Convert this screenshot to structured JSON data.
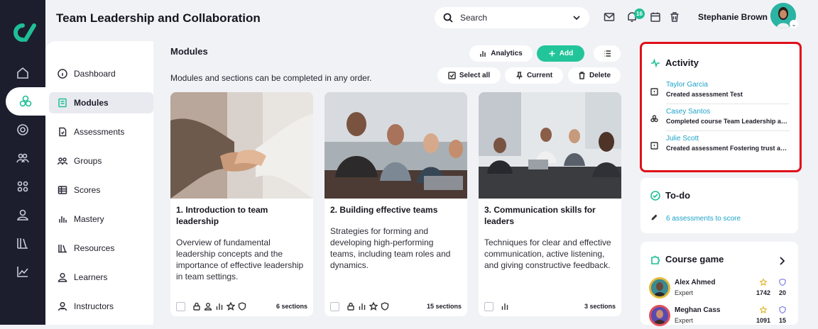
{
  "app": {
    "title": "Team Leadership and Collaboration"
  },
  "search": {
    "placeholder": "Search"
  },
  "header": {
    "notification_count": "16",
    "user_name": "Stephanie Brown"
  },
  "sidebar": {
    "items": [
      {
        "label": "Dashboard",
        "icon": "info-icon"
      },
      {
        "label": "Modules",
        "icon": "book-icon",
        "active": true
      },
      {
        "label": "Assessments",
        "icon": "assessment-icon"
      },
      {
        "label": "Groups",
        "icon": "groups-icon"
      },
      {
        "label": "Scores",
        "icon": "scores-icon"
      },
      {
        "label": "Mastery",
        "icon": "bar-chart-icon"
      },
      {
        "label": "Resources",
        "icon": "resources-icon"
      },
      {
        "label": "Learners",
        "icon": "user-icon"
      },
      {
        "label": "Instructors",
        "icon": "instructor-icon"
      }
    ]
  },
  "main": {
    "title": "Modules",
    "subtitle": "Modules and sections can be completed in any order.",
    "analytics_label": "Analytics",
    "add_label": "Add",
    "select_all_label": "Select all",
    "current_label": "Current",
    "delete_label": "Delete",
    "cards": [
      {
        "title": "1. Introduction to team leadership",
        "desc": "Overview of fundamental leadership concepts and the importance of effective leadership in team settings.",
        "sections": "6 sections"
      },
      {
        "title": "2. Building effective teams",
        "desc": "Strategies for forming and developing high-performing teams, including team roles and dynamics.",
        "sections": "15 sections"
      },
      {
        "title": "3. Communication skills for leaders",
        "desc": "Techniques for clear and effective communication, active listening, and giving constructive feedback.",
        "sections": "3 sections"
      }
    ]
  },
  "activity": {
    "title": "Activity",
    "items": [
      {
        "name": "Taylor Garcia",
        "desc": "Created assessment Test"
      },
      {
        "name": "Casey Santos",
        "desc": "Completed course Team Leadership and Collaboration"
      },
      {
        "name": "Julie Scott",
        "desc": "Created assessment Fostering trust and accountability"
      }
    ]
  },
  "todo": {
    "title": "To-do",
    "link": "6 assessments to score"
  },
  "game": {
    "title": "Course game",
    "players": [
      {
        "name": "Alex Ahmed",
        "role": "Expert",
        "points": "1742",
        "badges": "20"
      },
      {
        "name": "Meghan Cass",
        "role": "Expert",
        "points": "1091",
        "badges": "15"
      }
    ]
  },
  "colors": {
    "accent": "#1fbf95",
    "rail": "#1c1e2e",
    "link": "#1da3c8",
    "highlight": "#e0101a"
  }
}
